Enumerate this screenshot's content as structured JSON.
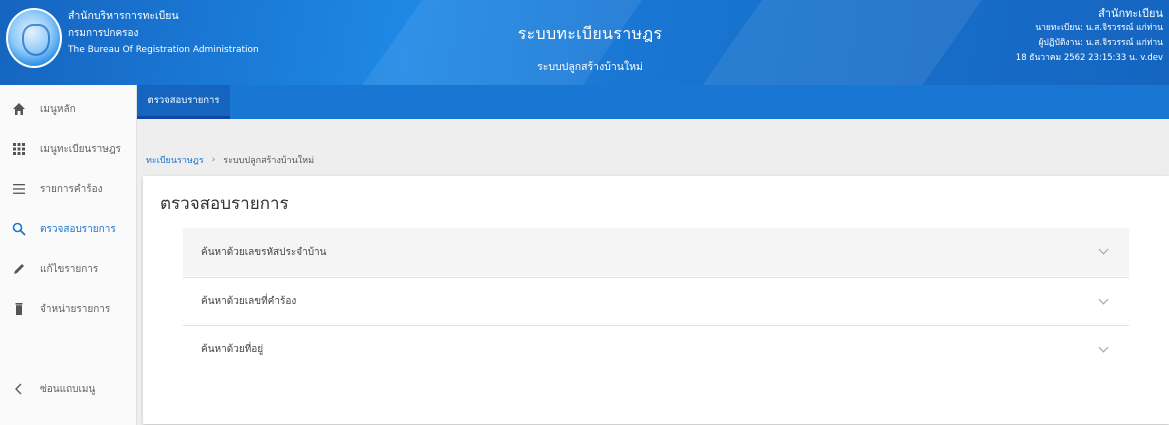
{
  "header": {
    "org_line1": "สำนักบริหารการทะเบียน",
    "org_line2": "กรมการปกครอง",
    "org_line3": "The Bureau Of Registration Administration",
    "system_title": "ระบบทะเบียนราษฎร",
    "system_subtitle": "ระบบปลูกสร้างบ้านใหม่",
    "user_office": "สำนักทะเบียน",
    "user_line1": "นายทะเบียน: น.ส.จิรวรรณ์ แก่ท่าน",
    "user_line2": "ผู้ปฏิบัติงาน: น.ส.จิรวรรณ์ แก่ท่าน",
    "user_datetime": "18 ธันวาคม 2562 23:15:33 น.  v.dev"
  },
  "sidebar": {
    "items": [
      {
        "label": "เมนูหลัก",
        "icon": "home-icon"
      },
      {
        "label": "เมนูทะเบียนราษฎร",
        "icon": "grid-icon"
      },
      {
        "label": "รายการคำร้อง",
        "icon": "list-icon"
      },
      {
        "label": "ตรวจสอบรายการ",
        "icon": "search-icon",
        "active": true
      },
      {
        "label": "แก้ไขรายการ",
        "icon": "pencil-icon"
      },
      {
        "label": "จำหน่ายรายการ",
        "icon": "trash-icon"
      },
      {
        "label": "ซ่อนแถบเมนู",
        "icon": "chevron-left-icon"
      }
    ]
  },
  "tabs": [
    {
      "label": "ตรวจสอบรายการ"
    }
  ],
  "breadcrumb": {
    "root": "ทะเบียนราษฎร",
    "separator": "›",
    "current": "ระบบปลูกสร้างบ้านใหม่"
  },
  "main": {
    "title": "ตรวจสอบรายการ",
    "panels": [
      {
        "label": "ค้นหาด้วยเลขรหัสประจำบ้าน"
      },
      {
        "label": "ค้นหาด้วยเลขที่คำร้อง"
      },
      {
        "label": "ค้นหาด้วยที่อยู่"
      }
    ]
  },
  "colors": {
    "primary": "#1976d2",
    "header_dark": "#1565c0",
    "background": "#eeeeee"
  }
}
